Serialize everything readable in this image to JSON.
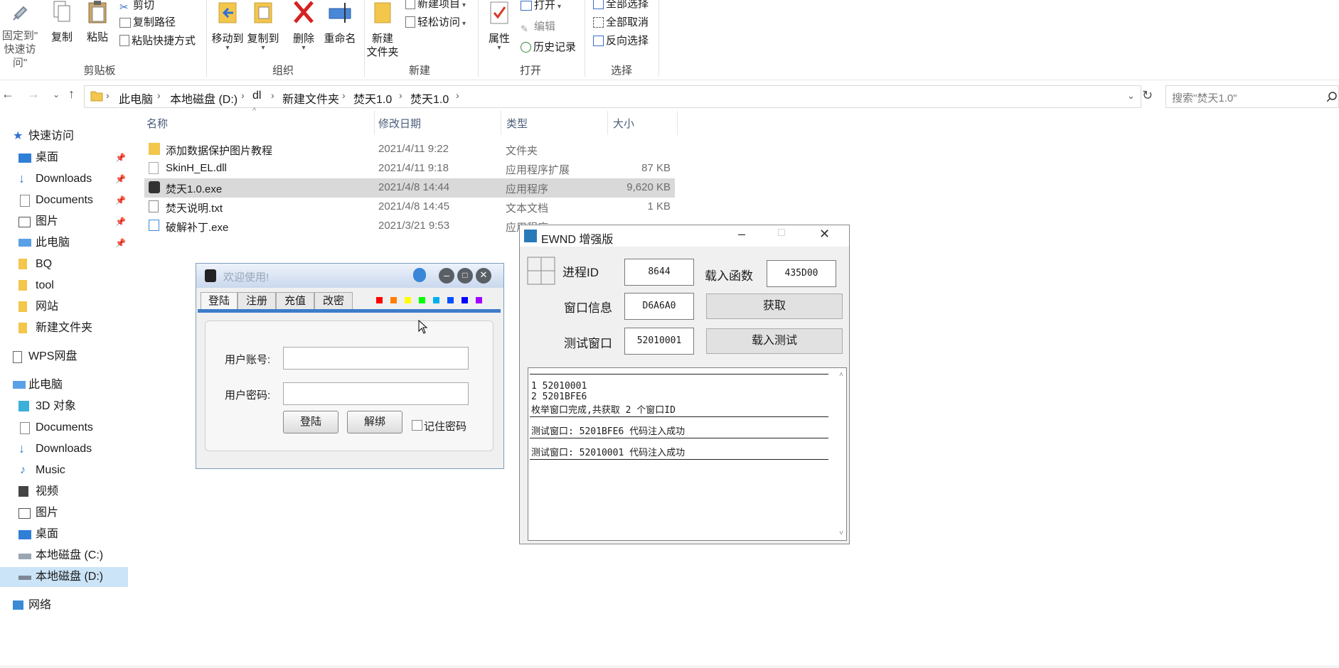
{
  "ribbon": {
    "pin_label_line1": "固定到\"",
    "pin_label_line2": "快速访问\"",
    "copy": "复制",
    "paste": "粘贴",
    "cut": "剪切",
    "copy_path": "复制路径",
    "paste_shortcut": "粘贴快捷方式",
    "move_to": "移动到",
    "copy_to": "复制到",
    "delete": "删除",
    "rename": "重命名",
    "new_folder_line1": "新建",
    "new_folder_line2": "文件夹",
    "new_item": "新建项目",
    "easy_access": "轻松访问",
    "properties": "属性",
    "open": "打开",
    "edit": "编辑",
    "history": "历史记录",
    "select_all": "全部选择",
    "select_none": "全部取消",
    "invert_selection": "反向选择",
    "groups": {
      "clipboard": "剪贴板",
      "organize": "组织",
      "new": "新建",
      "open": "打开",
      "select": "选择"
    }
  },
  "address": {
    "crumbs": [
      "此电脑",
      "本地磁盘 (D:)",
      "dl",
      "新建文件夹",
      "焚天1.0",
      "焚天1.0"
    ],
    "search_placeholder": "搜索\"焚天1.0\""
  },
  "nav": {
    "quick_access": "快速访问",
    "quick_items": [
      "桌面",
      "Downloads",
      "Documents",
      "图片",
      "此电脑",
      "BQ",
      "tool",
      "网站",
      "新建文件夹"
    ],
    "wps": "WPS网盘",
    "this_pc": "此电脑",
    "pc_items": [
      "3D 对象",
      "Documents",
      "Downloads",
      "Music",
      "视频",
      "图片",
      "桌面",
      "本地磁盘 (C:)",
      "本地磁盘 (D:)"
    ],
    "network": "网络"
  },
  "columns": {
    "name": "名称",
    "date": "修改日期",
    "type": "类型",
    "size": "大小"
  },
  "files": [
    {
      "name": "添加数据保护图片教程",
      "date": "2021/4/11 9:22",
      "type": "文件夹",
      "size": ""
    },
    {
      "name": "SkinH_EL.dll",
      "date": "2021/4/11 9:18",
      "type": "应用程序扩展",
      "size": "87 KB"
    },
    {
      "name": "焚天1.0.exe",
      "date": "2021/4/8 14:44",
      "type": "应用程序",
      "size": "9,620 KB"
    },
    {
      "name": "焚天说明.txt",
      "date": "2021/4/8 14:45",
      "type": "文本文档",
      "size": "1 KB"
    },
    {
      "name": "破解补丁.exe",
      "date": "2021/3/21 9:53",
      "type": "应用程序",
      "size": ""
    }
  ],
  "login": {
    "title": "欢迎使用!",
    "tabs": [
      "登陆",
      "注册",
      "充值",
      "改密"
    ],
    "swatches": [
      "#ff0000",
      "#ff7f00",
      "#ffff00",
      "#00ff00",
      "#00b0f0",
      "#0050ff",
      "#0000ff",
      "#a000ff"
    ],
    "account_label": "用户账号:",
    "password_label": "用户密码:",
    "login_btn": "登陆",
    "unbind_btn": "解绑",
    "remember": "记住密码"
  },
  "ewnd": {
    "title": "EWND 增强版",
    "pid_label": "进程ID",
    "pid_value": "8644",
    "load_func_label": "载入函数",
    "load_func_value": "435D00",
    "wininfo_label": "窗口信息",
    "wininfo_value": "D6A6A0",
    "get_btn": "获取",
    "test_label": "测试窗口",
    "test_value": "52010001",
    "load_test_btn": "载入测试",
    "log": {
      "line1": "1 52010001",
      "line2": "2 5201BFE6",
      "line3": "枚举窗口完成,共获取 2 个窗口ID",
      "line4": "测试窗口: 5201BFE6 代码注入成功",
      "line5": "测试窗口: 52010001 代码注入成功"
    }
  }
}
